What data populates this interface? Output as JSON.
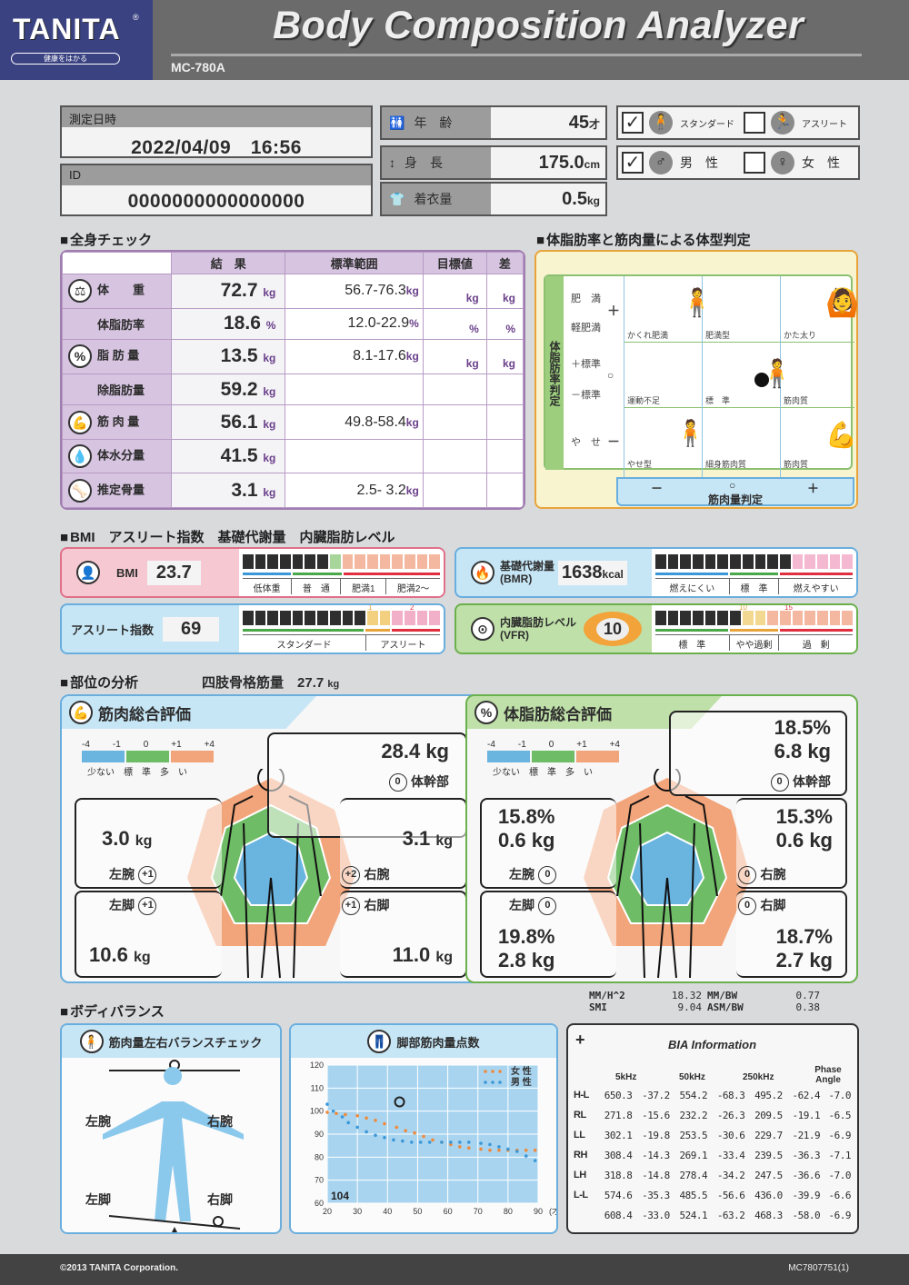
{
  "header": {
    "brand": "TANITA",
    "brand_registered": "®",
    "brand_tagline": "健康をはかる",
    "title": "Body Composition Analyzer",
    "model": "MC-780A"
  },
  "measurement": {
    "datetime_label": "測定日時",
    "datetime_value": "2022/04/09　16:56",
    "id_label": "ID",
    "id_value": "0000000000000000",
    "age_label": "年　齢",
    "age_value": "45",
    "age_unit": "才",
    "height_label": "身　長",
    "height_value": "175.0",
    "height_unit": "cm",
    "clothes_label": "着衣量",
    "clothes_value": "0.5",
    "clothes_unit": "kg",
    "body_type_options": [
      {
        "label": "スタンダード",
        "checked": true,
        "check": "✓"
      },
      {
        "label": "アスリート",
        "checked": false,
        "check": ""
      }
    ],
    "gender_options": [
      {
        "label": "男　性",
        "checked": true,
        "check": "✓"
      },
      {
        "label": "女　性",
        "checked": false,
        "check": ""
      }
    ]
  },
  "whole_body": {
    "section_title": "全身チェック",
    "headers": [
      "結　果",
      "標準範囲",
      "目標値",
      "差"
    ],
    "rows": [
      {
        "label": "体　　重",
        "result": "72.7",
        "unit": "kg",
        "range": "56.7-76.3",
        "range_unit": "kg",
        "target_unit": "kg",
        "diff_unit": "kg"
      },
      {
        "label": "体脂肪率",
        "result": "18.6",
        "unit": "%",
        "range": "12.0-22.9",
        "range_unit": "%",
        "target_unit": "%",
        "diff_unit": "%"
      },
      {
        "label": "脂 肪 量",
        "result": "13.5",
        "unit": "kg",
        "range": "8.1-17.6",
        "range_unit": "kg",
        "target_unit": "kg",
        "diff_unit": "kg"
      },
      {
        "label": "除脂肪量",
        "result": "59.2",
        "unit": "kg",
        "range": "",
        "range_unit": ""
      },
      {
        "label": "筋 肉 量",
        "result": "56.1",
        "unit": "kg",
        "range": "49.8-58.4",
        "range_unit": "kg"
      },
      {
        "label": "体水分量",
        "result": "41.5",
        "unit": "kg",
        "range": "",
        "range_unit": ""
      },
      {
        "label": "推定骨量",
        "result": "3.1",
        "unit": "kg",
        "range": "2.5- 3.2",
        "range_unit": "kg"
      }
    ]
  },
  "body_type": {
    "section_title": "体脂肪率と筋肉量による体型判定",
    "y_axis_title": "体脂肪率判定",
    "x_axis_title": "筋肉量判定",
    "y_levels": [
      "肥　満",
      "軽肥満",
      "＋標準",
      "－標準",
      "や　せ"
    ],
    "y_signs": [
      "＋",
      "○",
      "－"
    ],
    "x_signs": [
      "－",
      "○",
      "＋"
    ],
    "cells": [
      [
        "かくれ肥満",
        "肥満型",
        "かた太り"
      ],
      [
        "運動不足",
        "標　準",
        "筋肉質"
      ],
      [
        "やせ型",
        "細身筋肉質",
        "筋肉質"
      ]
    ],
    "result_marker": {
      "fat_level": "+標準",
      "muscle_level": "○ (標準, upper-right)"
    }
  },
  "indices": {
    "section_title": "BMI　アスリート指数　基礎代謝量　内臓脂肪レベル",
    "bmi": {
      "label": "BMI",
      "value": "23.7",
      "filled": 7,
      "total": 16,
      "categories": [
        "低体重",
        "普　通",
        "肥満1",
        "肥満2～"
      ]
    },
    "athlete": {
      "label": "アスリート指数",
      "value": "69",
      "filled": 10,
      "total": 16,
      "markers": [
        "1",
        "2"
      ],
      "categories": [
        "スタンダード",
        "アスリート"
      ]
    },
    "bmr": {
      "label": "基礎代謝量",
      "sublabel": "(BMR)",
      "value": "1638",
      "unit": "kcal",
      "filled": 11,
      "total": 16,
      "categories": [
        "燃えにくい",
        "標　準",
        "燃えやすい"
      ]
    },
    "vfr": {
      "label": "内臓脂肪レベル",
      "sublabel": "(VFR)",
      "value": "10",
      "filled": 7,
      "total": 16,
      "markers": [
        "10",
        "15"
      ],
      "categories": [
        "標　準",
        "やや過剰",
        "過　剰"
      ]
    }
  },
  "segmental": {
    "section_title": "部位の分析",
    "appendicular_label": "四肢骨格筋量",
    "appendicular_value": "27.7",
    "appendicular_unit": "kg",
    "legend_nums": [
      "-4",
      "-1",
      "0",
      "+1",
      "+4"
    ],
    "legend_labels": [
      "少ない",
      "標　準",
      "多　い"
    ],
    "colors": {
      "low": "#6ab4e0",
      "standard": "#6fbc66",
      "high": "#f2a47a"
    },
    "muscle": {
      "title": "筋肉総合評価",
      "trunk": {
        "value": "28.4 kg",
        "score": "0",
        "label": "体幹部"
      },
      "left_arm": {
        "value": "3.0",
        "unit": "kg",
        "score": "+1",
        "label": "左腕"
      },
      "right_arm": {
        "value": "3.1",
        "unit": "kg",
        "score": "+2",
        "label": "右腕"
      },
      "left_leg": {
        "value": "10.6",
        "unit": "kg",
        "score": "+1",
        "label": "左脚"
      },
      "right_leg": {
        "value": "11.0",
        "unit": "kg",
        "score": "+1",
        "label": "右脚"
      }
    },
    "fat": {
      "title": "体脂肪総合評価",
      "trunk": {
        "pct": "18.5%",
        "kg": "6.8 kg",
        "score": "0",
        "label": "体幹部"
      },
      "left_arm": {
        "pct": "15.8%",
        "kg": "0.6 kg",
        "score": "0",
        "label": "左腕"
      },
      "right_arm": {
        "pct": "15.3%",
        "kg": "0.6 kg",
        "score": "0",
        "label": "右腕"
      },
      "left_leg": {
        "pct": "19.8%",
        "kg": "2.8 kg",
        "score": "0",
        "label": "左脚"
      },
      "right_leg": {
        "pct": "18.7%",
        "kg": "2.7 kg",
        "score": "0",
        "label": "右脚"
      }
    }
  },
  "indices_extra": [
    {
      "label": "MM/H^2",
      "value": "18.32"
    },
    {
      "label": "MM/BW",
      "value": "0.77"
    },
    {
      "label": "SMI",
      "value": "9.04"
    },
    {
      "label": "ASM/BW",
      "value": "0.38"
    }
  ],
  "body_balance": {
    "section_title": "ボディバランス",
    "balance_title": "筋肉量左右バランスチェック",
    "labels": [
      "左腕",
      "右腕",
      "左脚",
      "右脚"
    ]
  },
  "chart_data": {
    "type": "scatter",
    "title": "脚部筋肉量点数",
    "xlabel": "(才)",
    "ylabel": "",
    "xlim": [
      20,
      90
    ],
    "ylim": [
      60,
      120
    ],
    "xticks": [
      20,
      30,
      40,
      50,
      60,
      70,
      80,
      90
    ],
    "yticks": [
      60,
      70,
      80,
      90,
      100,
      110,
      120
    ],
    "grid": true,
    "legend": "top-right",
    "score_label": "104",
    "marker": {
      "x": 44,
      "y": 104
    },
    "series": [
      {
        "name": "女 性",
        "color": "#ee8a3c",
        "x": [
          20,
          23,
          26,
          30,
          33,
          36,
          39,
          43,
          46,
          49,
          52,
          55,
          58,
          61,
          64,
          67,
          71,
          74,
          77,
          80,
          83,
          86,
          89
        ],
        "y": [
          99.5,
          99,
          98.5,
          98,
          97,
          96,
          94.5,
          93,
          91.5,
          90.5,
          89,
          87.5,
          86.5,
          85.5,
          84.5,
          84,
          83.5,
          83,
          83,
          83,
          83,
          83,
          83
        ]
      },
      {
        "name": "男 性",
        "color": "#3a98d8",
        "x": [
          20,
          22,
          25,
          27,
          30,
          33,
          36,
          39,
          42,
          45,
          48,
          51,
          54,
          58,
          61,
          64,
          67,
          71,
          74,
          77,
          80,
          83,
          86,
          89
        ],
        "y": [
          103,
          100,
          97.5,
          95,
          93,
          91,
          89.5,
          88.5,
          87.5,
          87,
          86.5,
          86.5,
          86.5,
          86.5,
          86.5,
          86.5,
          86.5,
          86,
          85.5,
          84.5,
          83.5,
          82.5,
          80.5,
          78.5
        ]
      }
    ]
  },
  "bia": {
    "title": "BIA Information",
    "headers": [
      "5kHz",
      "50kHz",
      "250kHz",
      "Phase Angle"
    ],
    "rows": [
      {
        "key": "H-L",
        "vals": [
          "650.3",
          "-37.2",
          "554.2",
          "-68.3",
          "495.2",
          "-62.4",
          "-7.0"
        ]
      },
      {
        "key": "RL",
        "vals": [
          "271.8",
          "-15.6",
          "232.2",
          "-26.3",
          "209.5",
          "-19.1",
          "-6.5"
        ]
      },
      {
        "key": "LL",
        "vals": [
          "302.1",
          "-19.8",
          "253.5",
          "-30.6",
          "229.7",
          "-21.9",
          "-6.9"
        ]
      },
      {
        "key": "RH",
        "vals": [
          "308.4",
          "-14.3",
          "269.1",
          "-33.4",
          "239.5",
          "-36.3",
          "-7.1"
        ]
      },
      {
        "key": "LH",
        "vals": [
          "318.8",
          "-14.8",
          "278.4",
          "-34.2",
          "247.5",
          "-36.6",
          "-7.0"
        ]
      },
      {
        "key": "L-L",
        "vals": [
          "574.6",
          "-35.3",
          "485.5",
          "-56.6",
          "436.0",
          "-39.9",
          "-6.6"
        ]
      },
      {
        "key": "",
        "vals": [
          "608.4",
          "-33.0",
          "524.1",
          "-63.2",
          "468.3",
          "-58.0",
          "-6.9"
        ]
      }
    ]
  },
  "footer": {
    "copyright": "©2013 TANITA Corporation.",
    "code": "MC7807751(1)"
  }
}
